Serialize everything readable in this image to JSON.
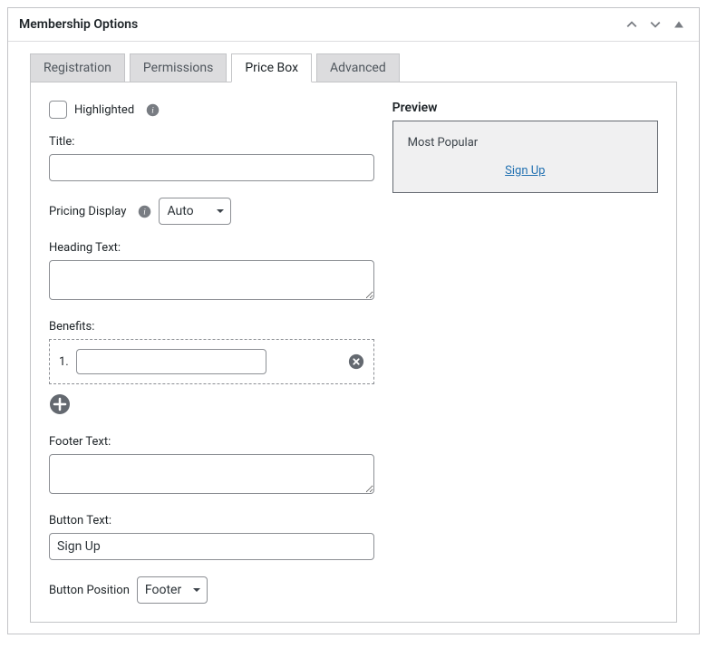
{
  "panel": {
    "title": "Membership Options"
  },
  "tabs": {
    "items": [
      {
        "label": "Registration"
      },
      {
        "label": "Permissions"
      },
      {
        "label": "Price Box",
        "active": true
      },
      {
        "label": "Advanced"
      }
    ]
  },
  "form": {
    "highlighted_label": "Highlighted",
    "title_label": "Title:",
    "title_value": "",
    "pricing_display_label": "Pricing Display",
    "pricing_display_value": "Auto",
    "heading_text_label": "Heading Text:",
    "heading_text_value": "",
    "benefits_label": "Benefits:",
    "benefit_num": "1.",
    "benefit_value": "",
    "footer_text_label": "Footer Text:",
    "footer_text_value": "",
    "button_text_label": "Button Text:",
    "button_text_value": "Sign Up",
    "button_position_label": "Button Position",
    "button_position_value": "Footer"
  },
  "preview": {
    "heading": "Preview",
    "box_title": "Most Popular",
    "link_text": "Sign Up"
  }
}
